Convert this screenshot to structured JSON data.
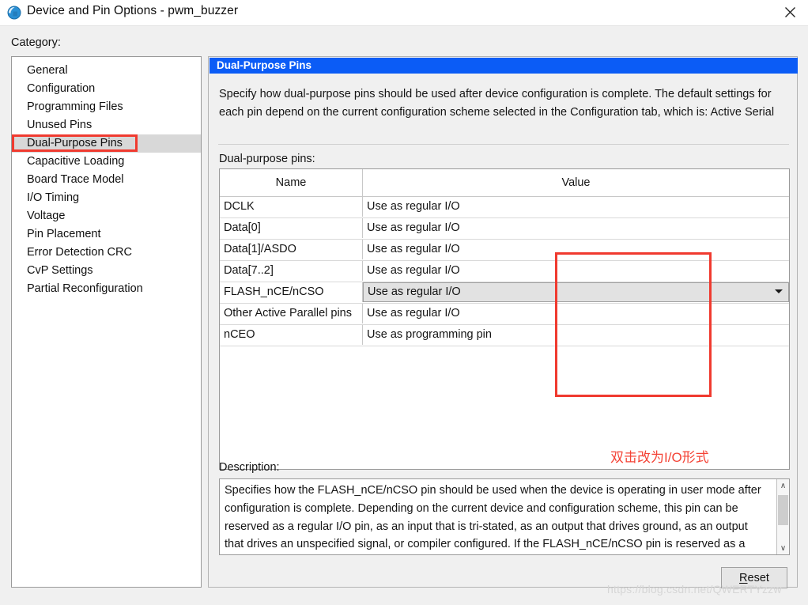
{
  "window": {
    "title": "Device and Pin Options - pwm_buzzer",
    "icon": "quartus-globe-icon",
    "close_label": "✕"
  },
  "sidebar": {
    "label": "Category:",
    "items": [
      {
        "label": "General"
      },
      {
        "label": "Configuration"
      },
      {
        "label": "Programming Files"
      },
      {
        "label": "Unused Pins"
      },
      {
        "label": "Dual-Purpose Pins"
      },
      {
        "label": "Capacitive Loading"
      },
      {
        "label": "Board Trace Model"
      },
      {
        "label": "I/O Timing"
      },
      {
        "label": "Voltage"
      },
      {
        "label": "Pin Placement"
      },
      {
        "label": "Error Detection CRC"
      },
      {
        "label": "CvP Settings"
      },
      {
        "label": "Partial Reconfiguration"
      }
    ],
    "selected_index": 4
  },
  "panel": {
    "header": "Dual-Purpose Pins",
    "intro": "Specify how dual-purpose pins should be used after device configuration is complete. The default settings for each pin depend on the current configuration scheme selected in the Configuration tab, which is: Active Serial",
    "pins_label": "Dual-purpose pins:"
  },
  "table": {
    "columns": [
      "Name",
      "Value"
    ],
    "rows": [
      {
        "name": "DCLK",
        "value": "Use as regular I/O"
      },
      {
        "name": "Data[0]",
        "value": "Use as regular I/O"
      },
      {
        "name": "Data[1]/ASDO",
        "value": "Use as regular I/O"
      },
      {
        "name": "Data[7..2]",
        "value": "Use as regular I/O"
      },
      {
        "name": "FLASH_nCE/nCSO",
        "value": "Use as regular I/O"
      },
      {
        "name": "Other Active Parallel pins",
        "value": "Use as regular I/O"
      },
      {
        "name": "nCEO",
        "value": "Use as programming pin"
      }
    ],
    "active_row_index": 4
  },
  "annotation": {
    "note": "双击改为I/O形式",
    "color": "#f44336"
  },
  "description": {
    "label": "Description:",
    "text": "Specifies how the FLASH_nCE/nCSO pin should be used when the device is operating in user mode after configuration is complete. Depending on the current device and configuration scheme, this pin can be reserved as a regular I/O pin, as an input that is tri-stated, as an output that drives ground, as an output that drives an unspecified signal, or compiler configured. If the FLASH_nCE/nCSO pin is reserved as a regular I/O pin, the FLASH_nCE/nCSO pin can be used as an ordinary I/O pin after",
    "scroll_up": "∧",
    "scroll_down": "∨"
  },
  "footer": {
    "reset_label": "Reset",
    "reset_accel": "R",
    "watermark": "https://blog.csdn.net/QWERTYzzw"
  },
  "colors": {
    "header_blue": "#0b5cf6",
    "annotation_red": "#f03a2f",
    "selection_gray": "#d8d8d8"
  }
}
